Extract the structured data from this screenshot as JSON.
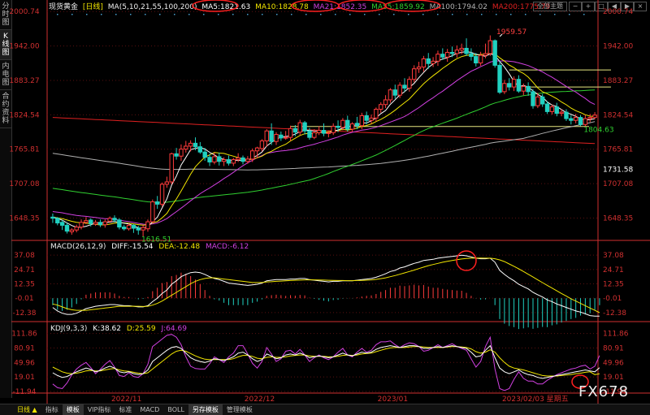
{
  "sidebar": {
    "tabs": [
      {
        "label": "分时图"
      },
      {
        "label": "K线图"
      },
      {
        "label": "内电图"
      },
      {
        "label": "合约资料"
      }
    ],
    "active": 1
  },
  "header": {
    "symbol": "现货黄金",
    "period": "[日线]",
    "ma_label": "MA(5,10,21,55,100,200)",
    "ma": [
      {
        "text": "MA5:1821.63",
        "color": "#ffffff"
      },
      {
        "text": "MA10:1828.78",
        "color": "#f2e600"
      },
      {
        "text": "MA21:1852.35",
        "color": "#d040e0"
      },
      {
        "text": "MA55:1859.92",
        "color": "#30d030"
      },
      {
        "text": "MA100:1794.02",
        "color": "#b0b0b0"
      },
      {
        "text": "MA200:1775.79",
        "color": "#e02020"
      }
    ],
    "mode_button": "全部主题"
  },
  "colors": {
    "up": "#ff3b3b",
    "down": "#20d0c0",
    "grid": "#5a1010",
    "axis": "#d03030",
    "hline": "#e6e680"
  },
  "chart_data": {
    "type": "candlestick",
    "price_axis": {
      "ticks": [
        2000.74,
        1942.0,
        1883.27,
        1824.54,
        1765.81,
        1707.08,
        1648.35
      ],
      "range": [
        1613,
        2001
      ]
    },
    "annotations": {
      "high": "1959.57",
      "low": "1616.51",
      "last_low": "1804.63",
      "right_value": "1731.58"
    },
    "hlines": [
      1901,
      1872,
      1804.63
    ],
    "x_labels": [
      "2022/11",
      "2022/12",
      "2023/01",
      "2023/02/03 星期五"
    ],
    "candles": [
      [
        1650,
        1648,
        1656,
        1640
      ],
      [
        1648,
        1640,
        1650,
        1636
      ],
      [
        1641,
        1636,
        1645,
        1628
      ],
      [
        1636,
        1626,
        1640,
        1622
      ],
      [
        1625,
        1628,
        1631,
        1620
      ],
      [
        1628,
        1633,
        1637,
        1624
      ],
      [
        1633,
        1641,
        1646,
        1629
      ],
      [
        1641,
        1644,
        1650,
        1638
      ],
      [
        1645,
        1639,
        1648,
        1634
      ],
      [
        1638,
        1641,
        1645,
        1635
      ],
      [
        1641,
        1637,
        1646,
        1633
      ],
      [
        1637,
        1642,
        1646,
        1632
      ],
      [
        1643,
        1648,
        1651,
        1640
      ],
      [
        1648,
        1645,
        1653,
        1641
      ],
      [
        1645,
        1633,
        1648,
        1629
      ],
      [
        1633,
        1630,
        1637,
        1627
      ],
      [
        1630,
        1636,
        1639,
        1627
      ],
      [
        1636,
        1631,
        1638,
        1623
      ],
      [
        1631,
        1628,
        1635,
        1620
      ],
      [
        1628,
        1632,
        1636,
        1617
      ],
      [
        1630,
        1642,
        1646,
        1625
      ],
      [
        1642,
        1676,
        1680,
        1640
      ],
      [
        1676,
        1672,
        1686,
        1664
      ],
      [
        1672,
        1706,
        1709,
        1668
      ],
      [
        1706,
        1710,
        1719,
        1700
      ],
      [
        1710,
        1758,
        1760,
        1706
      ],
      [
        1758,
        1754,
        1768,
        1748
      ],
      [
        1754,
        1766,
        1774,
        1746
      ],
      [
        1766,
        1771,
        1780,
        1760
      ],
      [
        1771,
        1776,
        1781,
        1762
      ],
      [
        1776,
        1770,
        1786,
        1764
      ],
      [
        1770,
        1761,
        1778,
        1758
      ],
      [
        1761,
        1752,
        1768,
        1746
      ],
      [
        1752,
        1744,
        1758,
        1737
      ],
      [
        1744,
        1753,
        1760,
        1740
      ],
      [
        1753,
        1745,
        1760,
        1738
      ],
      [
        1745,
        1748,
        1752,
        1737
      ],
      [
        1748,
        1742,
        1755,
        1738
      ],
      [
        1742,
        1748,
        1751,
        1737
      ],
      [
        1748,
        1751,
        1759,
        1744
      ],
      [
        1751,
        1745,
        1755,
        1740
      ],
      [
        1745,
        1749,
        1754,
        1741
      ],
      [
        1749,
        1763,
        1767,
        1744
      ],
      [
        1763,
        1768,
        1770,
        1750
      ],
      [
        1767,
        1780,
        1783,
        1762
      ],
      [
        1780,
        1797,
        1800,
        1770
      ],
      [
        1797,
        1779,
        1810,
        1773
      ],
      [
        1779,
        1791,
        1795,
        1773
      ],
      [
        1790,
        1785,
        1796,
        1780
      ],
      [
        1785,
        1786,
        1797,
        1782
      ],
      [
        1786,
        1801,
        1806,
        1780
      ],
      [
        1801,
        1795,
        1807,
        1788
      ],
      [
        1795,
        1811,
        1816,
        1790
      ],
      [
        1811,
        1797,
        1814,
        1791
      ],
      [
        1797,
        1786,
        1802,
        1782
      ],
      [
        1786,
        1794,
        1800,
        1783
      ],
      [
        1794,
        1798,
        1805,
        1790
      ],
      [
        1798,
        1793,
        1810,
        1788
      ],
      [
        1793,
        1794,
        1798,
        1786
      ],
      [
        1794,
        1805,
        1810,
        1790
      ],
      [
        1805,
        1803,
        1815,
        1795
      ],
      [
        1803,
        1815,
        1819,
        1798
      ],
      [
        1815,
        1800,
        1823,
        1796
      ],
      [
        1800,
        1809,
        1812,
        1796
      ],
      [
        1810,
        1806,
        1821,
        1800
      ],
      [
        1806,
        1823,
        1828,
        1800
      ],
      [
        1823,
        1815,
        1830,
        1808
      ],
      [
        1815,
        1819,
        1825,
        1809
      ],
      [
        1819,
        1834,
        1837,
        1813
      ],
      [
        1834,
        1842,
        1846,
        1828
      ],
      [
        1842,
        1850,
        1858,
        1836
      ],
      [
        1850,
        1867,
        1870,
        1845
      ],
      [
        1867,
        1858,
        1876,
        1852
      ],
      [
        1858,
        1875,
        1880,
        1853
      ],
      [
        1875,
        1870,
        1887,
        1864
      ],
      [
        1870,
        1885,
        1890,
        1864
      ],
      [
        1885,
        1903,
        1909,
        1880
      ],
      [
        1903,
        1906,
        1915,
        1896
      ],
      [
        1906,
        1920,
        1925,
        1898
      ],
      [
        1920,
        1912,
        1930,
        1903
      ],
      [
        1912,
        1916,
        1923,
        1906
      ],
      [
        1916,
        1928,
        1934,
        1908
      ],
      [
        1928,
        1923,
        1938,
        1918
      ],
      [
        1923,
        1931,
        1937,
        1915
      ],
      [
        1931,
        1929,
        1941,
        1923
      ],
      [
        1929,
        1935,
        1943,
        1922
      ],
      [
        1935,
        1938,
        1946,
        1928
      ],
      [
        1938,
        1929,
        1955,
        1925
      ],
      [
        1929,
        1924,
        1938,
        1917
      ],
      [
        1924,
        1913,
        1930,
        1907
      ],
      [
        1913,
        1926,
        1932,
        1908
      ],
      [
        1926,
        1929,
        1946,
        1921
      ],
      [
        1929,
        1951,
        1960,
        1925
      ],
      [
        1951,
        1909,
        1953,
        1905
      ],
      [
        1909,
        1863,
        1916,
        1860
      ],
      [
        1864,
        1878,
        1884,
        1860
      ],
      [
        1878,
        1872,
        1887,
        1866
      ],
      [
        1872,
        1885,
        1890,
        1865
      ],
      [
        1885,
        1865,
        1892,
        1862
      ],
      [
        1865,
        1873,
        1878,
        1858
      ],
      [
        1873,
        1864,
        1880,
        1857
      ],
      [
        1864,
        1840,
        1868,
        1835
      ],
      [
        1840,
        1855,
        1862,
        1836
      ],
      [
        1855,
        1843,
        1860,
        1838
      ],
      [
        1843,
        1830,
        1848,
        1826
      ],
      [
        1830,
        1838,
        1842,
        1825
      ],
      [
        1838,
        1827,
        1845,
        1822
      ],
      [
        1827,
        1829,
        1834,
        1822
      ],
      [
        1829,
        1818,
        1834,
        1814
      ],
      [
        1818,
        1815,
        1824,
        1808
      ],
      [
        1815,
        1820,
        1826,
        1810
      ],
      [
        1820,
        1808,
        1824,
        1805
      ],
      [
        1808,
        1818,
        1824,
        1804.63
      ],
      [
        1818,
        1820,
        1826,
        1812
      ],
      [
        1820,
        1824,
        1829,
        1817
      ]
    ],
    "macd": {
      "label": "MACD(26,12,9)",
      "diff": "DIFF:-15.54",
      "dea": "DEA:-12.48",
      "macd": "MACD:-6.12",
      "ticks": [
        37.08,
        24.71,
        12.35,
        -0.01,
        -12.38
      ],
      "range": [
        -16,
        40
      ],
      "diff_series": [
        -8,
        -11,
        -13,
        -14,
        -14,
        -13,
        -11,
        -9,
        -8,
        -7,
        -6.5,
        -6,
        -5.5,
        -5.5,
        -6,
        -6.5,
        -6.5,
        -7,
        -7.5,
        -7.5,
        -6.5,
        -3,
        0,
        4,
        7,
        12,
        15,
        18.5,
        20.5,
        22,
        22.5,
        22,
        20.5,
        18.5,
        17,
        16,
        14.5,
        13,
        12.5,
        12,
        11.5,
        11,
        11.5,
        12,
        13,
        15,
        15.5,
        16,
        16,
        16,
        16.5,
        16.5,
        17,
        17,
        16,
        15.5,
        15,
        14.5,
        14,
        14.5,
        14.5,
        15,
        15,
        15,
        15.5,
        16,
        16.5,
        17,
        18,
        19.5,
        21,
        23,
        24,
        26,
        27,
        28.5,
        30,
        31,
        32.5,
        33,
        33.5,
        34.5,
        35,
        35.5,
        36,
        36.5,
        37,
        36.5,
        35.5,
        34.5,
        34,
        34,
        34.5,
        31,
        24,
        20.5,
        17.5,
        15,
        12,
        10,
        8,
        5,
        3,
        1,
        -1.5,
        -3,
        -5,
        -6.5,
        -8,
        -9.5,
        -11,
        -12,
        -13.5,
        -15,
        -15.5,
        -15.5
      ],
      "dea_series": [
        -5,
        -6,
        -7.5,
        -9,
        -10,
        -10.5,
        -10.5,
        -10.5,
        -10,
        -9.5,
        -9,
        -8.5,
        -8,
        -7.5,
        -7,
        -7,
        -7,
        -7,
        -7,
        -7.2,
        -7,
        -6,
        -4.5,
        -2.5,
        0,
        2.5,
        5,
        7.5,
        10,
        12.5,
        14.5,
        16,
        17,
        17.5,
        17.5,
        17,
        16.5,
        16,
        15.5,
        15,
        14.5,
        14,
        13.5,
        13.5,
        13.5,
        14,
        14.2,
        14.5,
        14.7,
        15,
        15.2,
        15.4,
        15.6,
        15.8,
        15.8,
        15.8,
        15.7,
        15.6,
        15.4,
        15.3,
        15.2,
        15.2,
        15.1,
        15.1,
        15.2,
        15.3,
        15.5,
        15.8,
        16.2,
        16.8,
        17.5,
        18.5,
        19.5,
        20.6,
        21.8,
        23,
        24.2,
        25.5,
        26.8,
        28,
        29,
        30,
        31,
        31.8,
        32.5,
        33.2,
        33.8,
        34.2,
        34.5,
        34.6,
        34.6,
        34.5,
        34.5,
        34,
        33,
        31.5,
        29.5,
        27.5,
        25.3,
        23,
        20.6,
        18.2,
        15.8,
        13.4,
        11,
        8.7,
        6.3,
        4,
        1.8,
        -0.5,
        -2.5,
        -4.5,
        -6.5,
        -8.5,
        -10.5,
        -12.48
      ]
    },
    "kdj": {
      "label": "KDJ(9,3,3)",
      "k": "K:38.62",
      "d": "D:25.59",
      "j": "J:64.69",
      "ticks": [
        111.86,
        80.91,
        49.96,
        19.01,
        -11.94
      ],
      "range": [
        -12,
        113
      ],
      "k_series": [
        28,
        22,
        18,
        20,
        25,
        30,
        34,
        38,
        35,
        30,
        33,
        38,
        42,
        38,
        30,
        28,
        30,
        26,
        24,
        26,
        34,
        52,
        60,
        68,
        76,
        82,
        84,
        80,
        70,
        60,
        55,
        52,
        50,
        53,
        58,
        56,
        54,
        58,
        62,
        70,
        72,
        66,
        58,
        52,
        56,
        68,
        64,
        58,
        60,
        66,
        68,
        66,
        70,
        66,
        60,
        62,
        64,
        62,
        60,
        62,
        66,
        70,
        66,
        64,
        68,
        72,
        70,
        72,
        78,
        82,
        84,
        86,
        84,
        82,
        84,
        86,
        86,
        84,
        80,
        80,
        82,
        84,
        82,
        84,
        86,
        84,
        82,
        80,
        72,
        62,
        64,
        76,
        86,
        60,
        38,
        30,
        26,
        30,
        34,
        28,
        24,
        22,
        18,
        16,
        18,
        20,
        22,
        24,
        26,
        28,
        30,
        32,
        34,
        32,
        30,
        38.62
      ],
      "d_series": [
        40,
        35,
        30,
        27,
        26,
        27,
        29,
        32,
        33,
        32,
        32,
        34,
        36,
        37,
        34,
        32,
        31,
        29,
        27,
        26,
        28,
        36,
        44,
        52,
        60,
        68,
        74,
        76,
        74,
        69,
        64,
        60,
        57,
        56,
        56,
        56,
        56,
        56,
        58,
        62,
        65,
        65,
        63,
        59,
        58,
        61,
        62,
        61,
        61,
        62,
        64,
        65,
        66,
        66,
        64,
        63,
        63,
        63,
        62,
        62,
        63,
        65,
        66,
        65,
        66,
        68,
        69,
        70,
        73,
        76,
        79,
        81,
        82,
        82,
        82,
        83,
        84,
        84,
        83,
        82,
        82,
        82,
        82,
        83,
        84,
        84,
        83,
        82,
        79,
        73,
        70,
        72,
        77,
        72,
        60,
        50,
        42,
        38,
        36,
        34,
        31,
        28,
        25,
        22,
        21,
        21,
        21,
        22,
        23,
        24,
        26,
        27,
        29,
        30,
        24,
        25.59
      ],
      "j_series": [
        4,
        -4,
        -6,
        6,
        23,
        36,
        44,
        50,
        39,
        26,
        35,
        46,
        54,
        40,
        22,
        20,
        28,
        20,
        18,
        26,
        46,
        84,
        92,
        100,
        108,
        110,
        104,
        88,
        62,
        42,
        37,
        36,
        36,
        47,
        62,
        56,
        50,
        62,
        70,
        86,
        86,
        68,
        48,
        38,
        52,
        82,
        68,
        52,
        58,
        74,
        76,
        68,
        78,
        66,
        52,
        60,
        66,
        60,
        56,
        62,
        72,
        80,
        66,
        62,
        72,
        80,
        72,
        76,
        88,
        94,
        94,
        96,
        88,
        82,
        88,
        92,
        90,
        84,
        74,
        76,
        82,
        88,
        82,
        86,
        90,
        84,
        80,
        76,
        58,
        40,
        52,
        84,
        104,
        36,
        -6,
        -10,
        -6,
        14,
        30,
        16,
        10,
        10,
        4,
        4,
        12,
        18,
        24,
        28,
        32,
        36,
        38,
        42,
        44,
        36,
        42,
        64.69
      ]
    },
    "circles": [
      "MA5 label",
      "MA21 label",
      "MA55 label",
      "MA100 label",
      "MACD peak",
      "KDJ cross"
    ]
  },
  "bottom": {
    "left_label": "日线 ▲",
    "tabs": [
      {
        "label": "指标"
      },
      {
        "label": "模板"
      },
      {
        "label": "VIP指标"
      },
      {
        "label": "标准"
      },
      {
        "label": "MACD"
      },
      {
        "label": "BOLL"
      },
      {
        "label": "另存模板"
      },
      {
        "label": "管理模板"
      }
    ],
    "active_tab": 1
  },
  "brand": "FX678"
}
